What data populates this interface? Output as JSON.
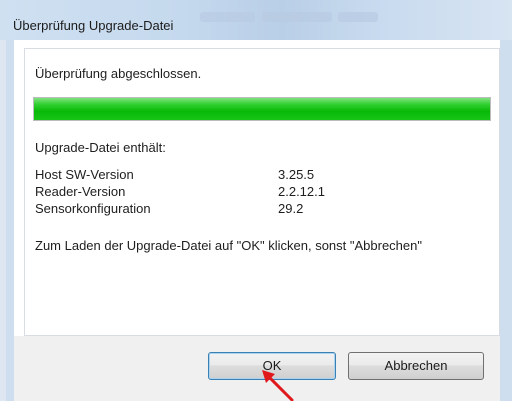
{
  "window": {
    "title": "Überprüfung Upgrade-Datei"
  },
  "status": {
    "message": "Überprüfung abgeschlossen.",
    "progress_percent": 100,
    "progress_color": "#0fbf0f"
  },
  "upgrade_info": {
    "heading": "Upgrade-Datei enthält:",
    "rows": [
      {
        "label": "Host SW-Version",
        "value": "3.25.5"
      },
      {
        "label": "Reader-Version",
        "value": "2.2.12.1"
      },
      {
        "label": "Sensorkonfiguration",
        "value": "29.2"
      }
    ]
  },
  "instruction": "Zum Laden der Upgrade-Datei auf \"OK\" klicken, sonst \"Abbrechen\"",
  "buttons": {
    "ok_label": "OK",
    "cancel_label": "Abbrechen"
  },
  "annotation": {
    "arrow_color": "#e0191c"
  }
}
